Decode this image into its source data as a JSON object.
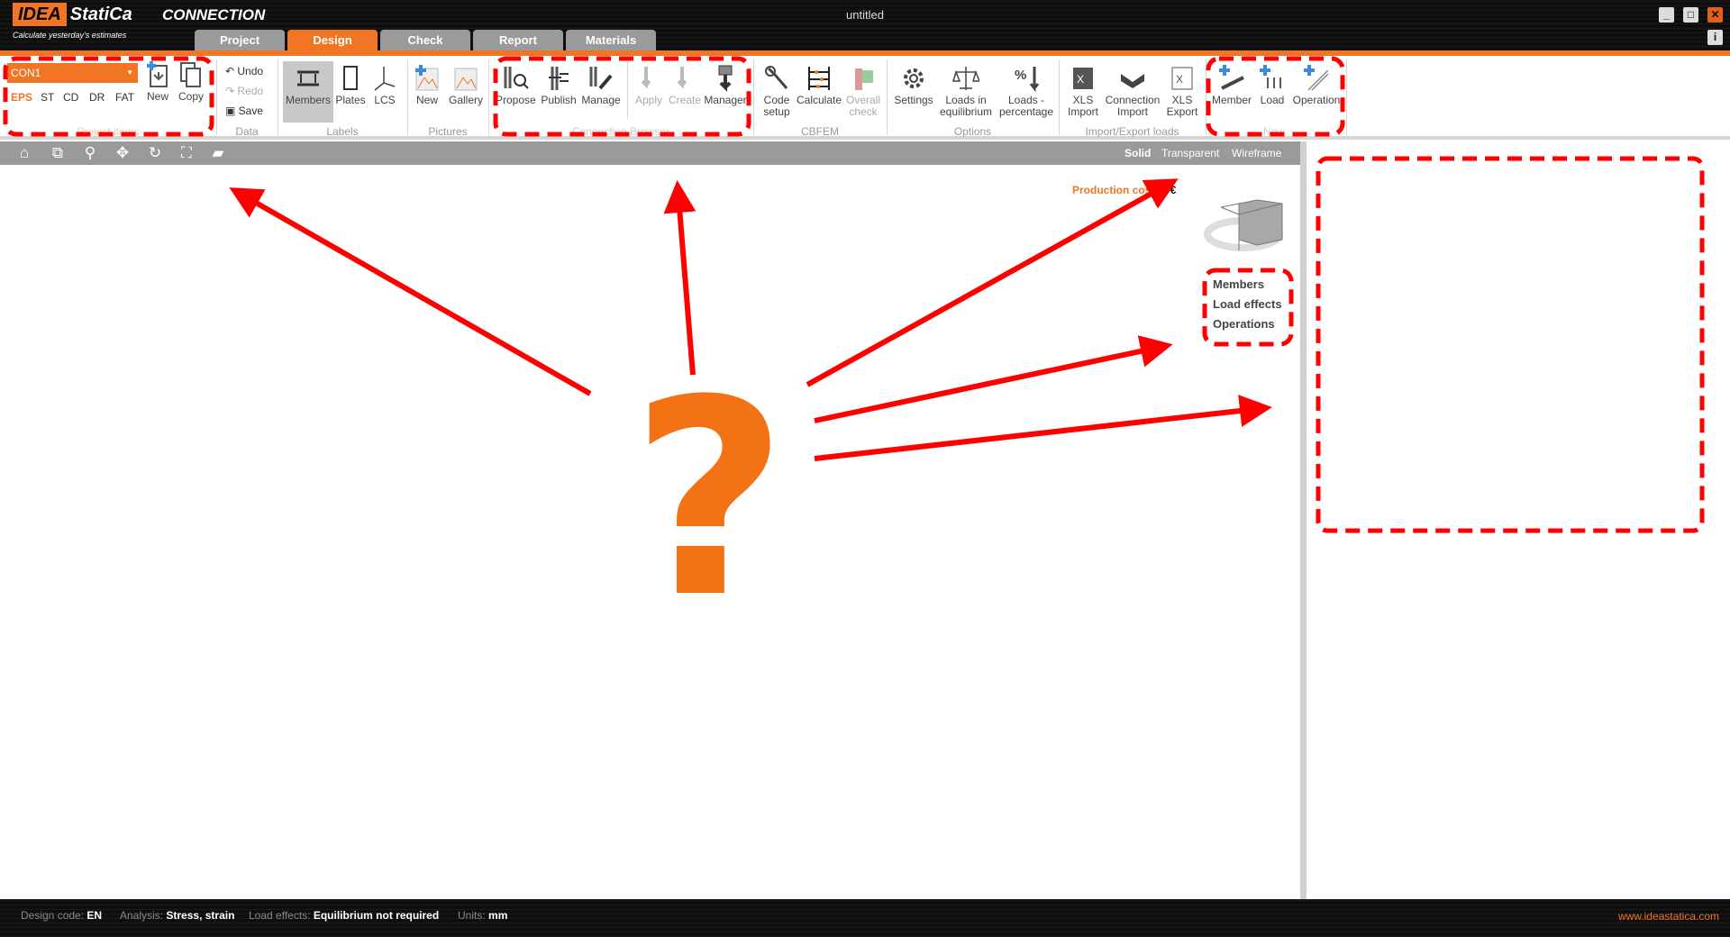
{
  "app": {
    "brand": "IDEA",
    "brand2": "StatiCa",
    "product": "CONNECTION",
    "slogan": "Calculate yesterday's estimates",
    "doc_title": "untitled"
  },
  "tabs": [
    "Project",
    "Design",
    "Check",
    "Report",
    "Materials"
  ],
  "active_tab": "Design",
  "window": {
    "minimize": "_",
    "maximize": "□",
    "close": "✕",
    "info": "i"
  },
  "ribbon": {
    "project_items": {
      "label": "Project items",
      "combo": "CON1",
      "types": [
        "EPS",
        "ST",
        "CD",
        "DR",
        "FAT"
      ],
      "new": "New",
      "copy": "Copy"
    },
    "data": {
      "label": "Data",
      "undo": "Undo",
      "redo": "Redo",
      "save": "Save"
    },
    "labels": {
      "label": "Labels",
      "members": "Members",
      "plates": "Plates",
      "lcs": "LCS"
    },
    "pictures": {
      "label": "Pictures",
      "new": "New",
      "gallery": "Gallery"
    },
    "browser": {
      "label": "Connection Browser",
      "propose": "Propose",
      "publish": "Publish",
      "manage": "Manage",
      "apply": "Apply",
      "create": "Create",
      "manager": "Manager"
    },
    "cbfem": {
      "label": "CBFEM",
      "code1": "Code",
      "code2": "setup",
      "calculate": "Calculate",
      "overall1": "Overall",
      "overall2": "check"
    },
    "options": {
      "label": "Options",
      "settings": "Settings",
      "leq1": "Loads in",
      "leq2": "equilibrium",
      "lp1": "Loads -",
      "lp2": "percentage"
    },
    "impexp": {
      "label": "Import/Export loads",
      "xi1": "XLS",
      "xi2": "Import",
      "ci1": "Connection",
      "ci2": "Import",
      "xe1": "XLS",
      "xe2": "Export"
    },
    "new": {
      "label": "New",
      "member": "Member",
      "load": "Load",
      "operation": "Operation"
    }
  },
  "view_modes": [
    "Solid",
    "Transparent",
    "Wireframe"
  ],
  "production_cost": {
    "label": "Production cost:",
    "value": "0 €"
  },
  "nav_links": [
    "Members",
    "Load effects",
    "Operations"
  ],
  "annotation": {
    "symbol": "?"
  },
  "status": {
    "design_code_label": "Design code:",
    "design_code": "EN",
    "analysis_label": "Analysis:",
    "analysis": "Stress, strain",
    "load_effects_label": "Load effects:",
    "load_effects": "Equilibrium not required",
    "units_label": "Units:",
    "units": "mm",
    "url": "www.ideastatica.com"
  },
  "colors": {
    "accent": "#f07524",
    "annotation": "#ff0000"
  }
}
